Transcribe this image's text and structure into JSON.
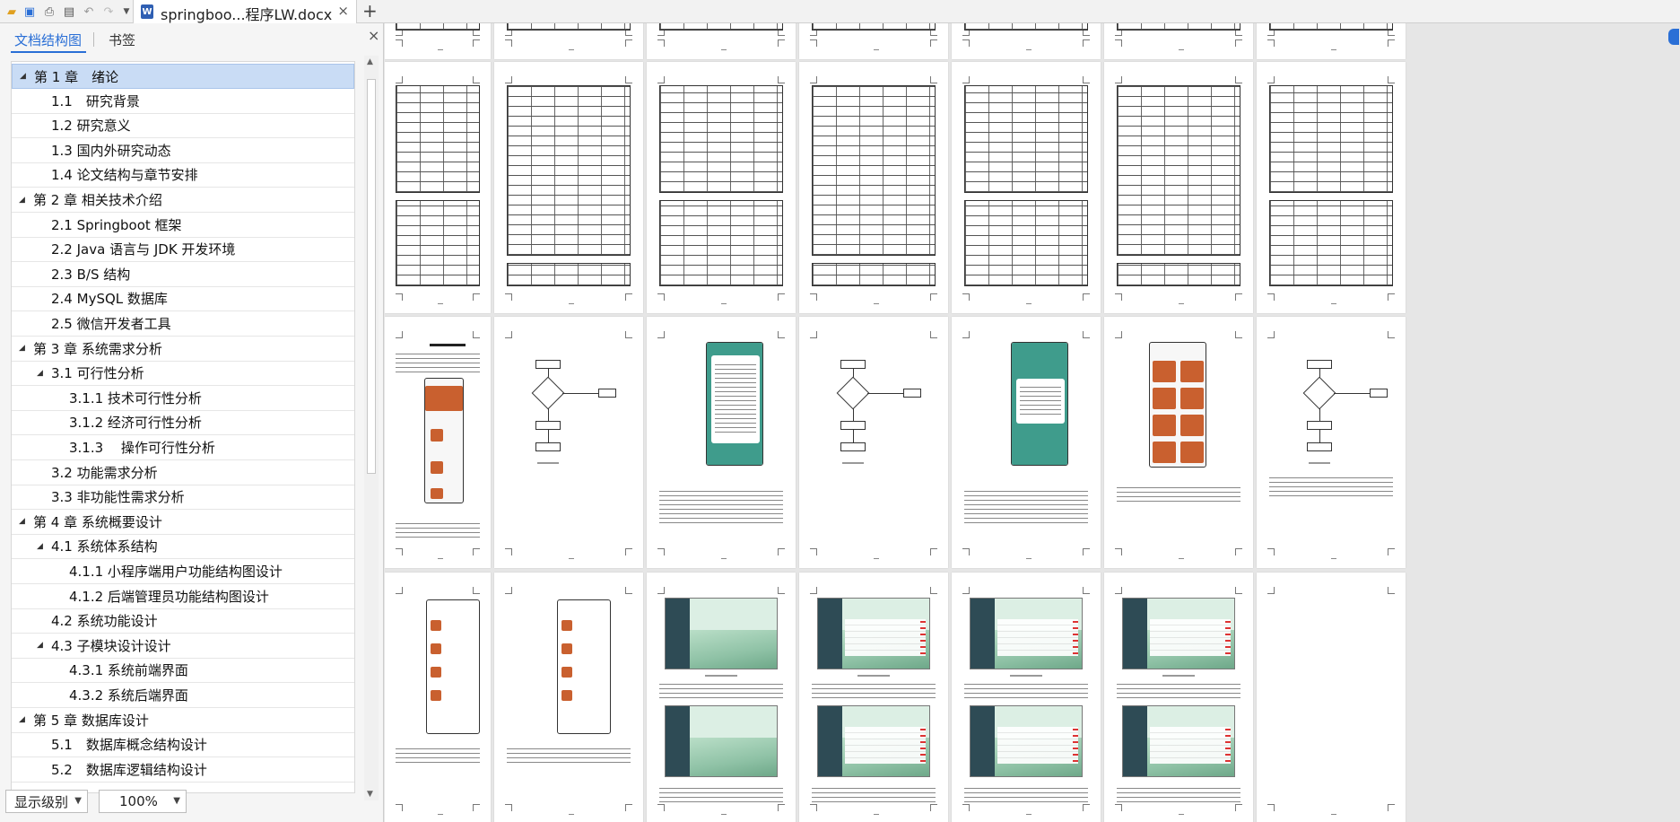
{
  "titlebar": {
    "quick_access": [
      "open-folder-icon",
      "save-icon",
      "print-icon",
      "print-preview-icon",
      "undo-icon",
      "redo-icon",
      "more-icon"
    ],
    "document_tab": {
      "icon": "word-doc-icon",
      "icon_letter": "W",
      "title": "springboo...程序LW.docx",
      "close": "×"
    },
    "new_tab": "+"
  },
  "nav": {
    "tab_outline": "文档结构图",
    "tab_bookmark": "书签",
    "close": "×",
    "items": [
      {
        "level": 1,
        "label": "第 1 章　绪论",
        "expanded": true,
        "selected": true
      },
      {
        "level": 2,
        "label": "1.1　研究背景"
      },
      {
        "level": 2,
        "label": "1.2  研究意义"
      },
      {
        "level": 2,
        "label": "1.3  国内外研究动态"
      },
      {
        "level": 2,
        "label": "1.4  论文结构与章节安排"
      },
      {
        "level": 1,
        "label": "第 2 章  相关技术介绍",
        "expanded": true
      },
      {
        "level": 2,
        "label": "2.1  Springboot 框架"
      },
      {
        "level": 2,
        "label": "2.2  Java 语言与 JDK 开发环境"
      },
      {
        "level": 2,
        "label": "2.3  B/S 结构"
      },
      {
        "level": 2,
        "label": "2.4  MySQL 数据库"
      },
      {
        "level": 2,
        "label": "2.5  微信开发者工具"
      },
      {
        "level": 1,
        "label": "第 3 章  系统需求分析",
        "expanded": true
      },
      {
        "level": 2,
        "label": "3.1  可行性分析",
        "expanded": true
      },
      {
        "level": 3,
        "label": "3.1.1  技术可行性分析"
      },
      {
        "level": 3,
        "label": "3.1.2  经济可行性分析"
      },
      {
        "level": 3,
        "label": "3.1.3　 操作可行性分析"
      },
      {
        "level": 2,
        "label": "3.2  功能需求分析"
      },
      {
        "level": 2,
        "label": "3.3  非功能性需求分析"
      },
      {
        "level": 1,
        "label": "第 4 章  系统概要设计",
        "expanded": true
      },
      {
        "level": 2,
        "label": "4.1  系统体系结构",
        "expanded": true
      },
      {
        "level": 3,
        "label": "4.1.1 小程序端用户功能结构图设计"
      },
      {
        "level": 3,
        "label": "4.1.2  后端管理员功能结构图设计"
      },
      {
        "level": 2,
        "label": "4.2  系统功能设计"
      },
      {
        "level": 2,
        "label": "4.3  子模块设计设计",
        "expanded": true
      },
      {
        "level": 3,
        "label": "4.3.1  系统前端界面"
      },
      {
        "level": 3,
        "label": "4.3.2  系统后端界面"
      },
      {
        "level": 1,
        "label": "第 5 章  数据库设计",
        "expanded": true
      },
      {
        "level": 2,
        "label": "5.1　数据库概念结构设计"
      },
      {
        "level": 2,
        "label": "5.2　数据库逻辑结构设计"
      }
    ],
    "level_dropdown": "显示级别",
    "zoom_dropdown": "100%"
  },
  "colors": {
    "accent": "#2a6fd6",
    "selection": "#c9dcf5",
    "teal_app": "#3f9c8c",
    "admin_sidebar": "#2e4b55"
  }
}
